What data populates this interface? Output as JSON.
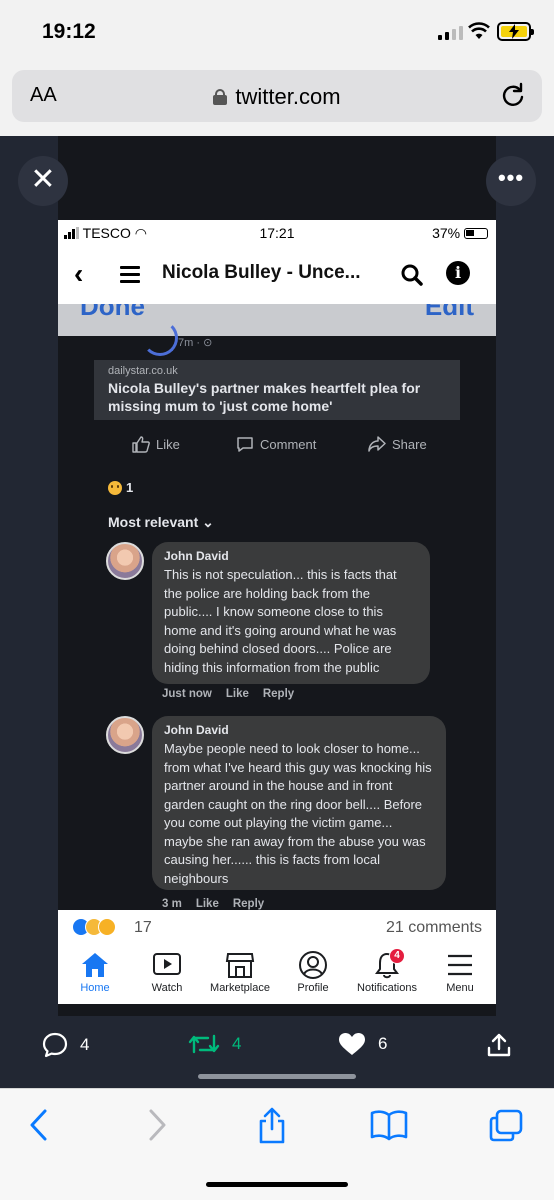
{
  "status_bar": {
    "time": "19:12"
  },
  "browser": {
    "text_size_label": "AA",
    "url": "twitter.com"
  },
  "inner_screenshot": {
    "status": {
      "carrier": "TESCO",
      "time": "17:21",
      "battery": "37%"
    },
    "header": {
      "title": "Nicola Bulley - Unce..."
    },
    "edit_bar": {
      "done_label": "Done",
      "edit_label": "Edit"
    },
    "post": {
      "time_ago": "7m · ",
      "link_source": "dailystar.co.uk",
      "link_title": "Nicola Bulley's partner makes heartfelt plea for missing mum to 'just come home'",
      "actions": {
        "like": "Like",
        "comment": "Comment",
        "share": "Share"
      },
      "reaction_count": "1",
      "sort_label": "Most relevant ⌄"
    },
    "comments": [
      {
        "author": "John David",
        "text": "This is not speculation... this is facts that the police are holding back from the public.... I know someone close to this home and it's going around what he was doing behind closed doors.... Police are hiding this information from the public",
        "time": "Just now",
        "like": "Like",
        "reply": "Reply"
      },
      {
        "author": "John David",
        "text": "Maybe people need to look closer to home... from what I've heard this guy was knocking his partner around in the house and in front garden caught on the ring door bell.... Before you come out playing the victim game... maybe she ran away from the abuse you was causing her...... this is facts from local neighbours",
        "time": "3 m",
        "like": "Like",
        "reply": "Reply"
      }
    ],
    "summary": {
      "reactions": "17",
      "comments": "21 comments"
    },
    "tabs": [
      {
        "label": "Home",
        "icon": "home-icon"
      },
      {
        "label": "Watch",
        "icon": "watch-icon"
      },
      {
        "label": "Marketplace",
        "icon": "marketplace-icon"
      },
      {
        "label": "Profile",
        "icon": "profile-icon"
      },
      {
        "label": "Notifications",
        "icon": "bell-icon",
        "badge": "4"
      },
      {
        "label": "Menu",
        "icon": "menu-icon"
      }
    ]
  },
  "tweet_actions": {
    "replies": "4",
    "retweets": "4",
    "likes": "6"
  },
  "colors": {
    "facebook_blue": "#1877f2",
    "retweet_green": "#00ba7c",
    "safari_blue": "#0a7aff"
  }
}
